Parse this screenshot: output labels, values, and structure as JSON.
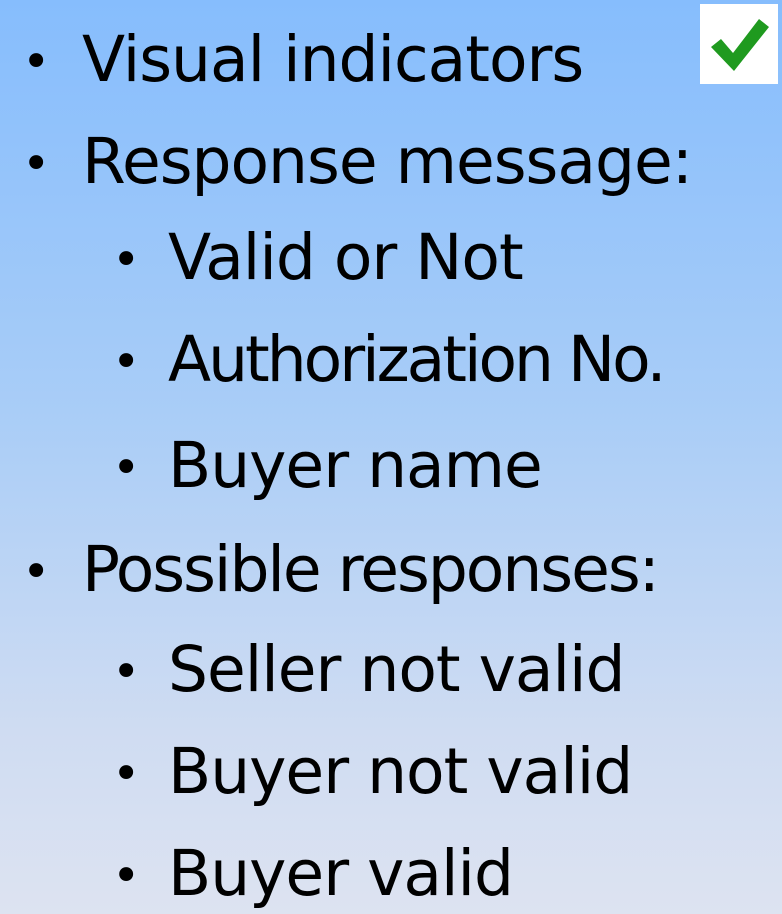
{
  "slide": {
    "items": [
      {
        "level": 1,
        "text": "Visual indicators"
      },
      {
        "level": 1,
        "text": "Response message:"
      },
      {
        "level": 2,
        "text": "Valid or Not"
      },
      {
        "level": 2,
        "text": "Authorization No."
      },
      {
        "level": 2,
        "text": "Buyer name"
      },
      {
        "level": 1,
        "text": "Possible responses:"
      },
      {
        "level": 2,
        "text": "Seller not valid"
      },
      {
        "level": 2,
        "text": "Buyer not valid"
      },
      {
        "level": 2,
        "text": "Buyer valid"
      }
    ],
    "bullet_glyph": "•",
    "indicator_icon": "checkmark-icon",
    "colors": {
      "checkmark": "#1f9a1f",
      "background_top": "#86bdfd",
      "background_bottom": "#dde3f1"
    }
  }
}
